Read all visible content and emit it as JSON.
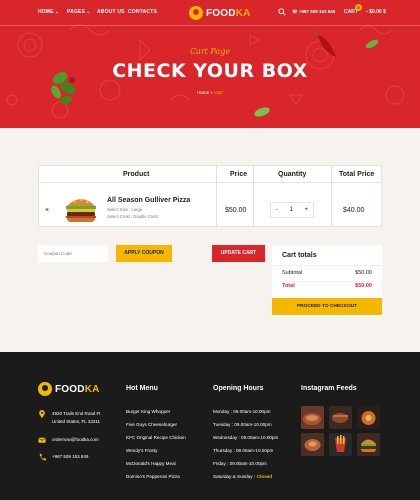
{
  "colors": {
    "brand_red": "#d8262b",
    "brand_yellow": "#f5b700",
    "footer_bg": "#1b1b1b",
    "page_bg": "#f6f3ee"
  },
  "nav": {
    "items": [
      {
        "label": "HOME",
        "has_dropdown": true
      },
      {
        "label": "PAGES",
        "has_dropdown": true
      },
      {
        "label": "ABOUT US",
        "has_dropdown": false
      },
      {
        "label": "CONTACTS",
        "has_dropdown": false
      }
    ],
    "logo": {
      "part1": "FOOD",
      "part2": "KA"
    },
    "search_icon": "search-icon",
    "phone": "+987 509 153 849",
    "cart_label": "CART",
    "cart_count": "0",
    "cart_total": "$0.00 $"
  },
  "hero": {
    "subtitle": "Cart Page",
    "title": "CHECK YOUR BOX",
    "breadcrumb": {
      "home": "Home",
      "separator": "»",
      "current": "Cart"
    }
  },
  "cart": {
    "headers": {
      "product": "Product",
      "price": "Price",
      "quantity": "Quantity",
      "total": "Total Price"
    },
    "items": [
      {
        "remove": "×",
        "name": "All Season Gulliver Pizza",
        "options": [
          "Select Size : Large",
          "Select Crust : Double Crust"
        ],
        "price": "$50.00",
        "qty_minus": "-",
        "qty": "1",
        "qty_plus": "+",
        "total": "$40.00"
      }
    ]
  },
  "coupon": {
    "placeholder": "Coupon Code",
    "apply_label": "APPLY COUPON",
    "update_label": "UPDATE CART"
  },
  "totals": {
    "title": "Cart totals",
    "subtotal_label": "Subtotal",
    "subtotal_value": "$50.00",
    "total_label": "Total",
    "total_value": "$50.00",
    "checkout_label": "PROCEED TO CHECKOUT"
  },
  "footer": {
    "logo": {
      "part1": "FOOD",
      "part2": "KA"
    },
    "address_line1": "4920 Trails End Road Ft",
    "address_line2": "United States, FL 33311",
    "email": "ordernow@foodka.com",
    "phone": "+987 509 153 849",
    "hot_menu_title": "Hot Menu",
    "hot_menu": [
      "Burger King Whopper",
      "Five Guys Cheeseburger",
      "KFC Original Recipe Chicken",
      "Wendy's Frosty",
      "McDonald's Happy Meal",
      "Domino's Pepperoni Pizza"
    ],
    "hours_title": "Opening Hours",
    "hours": [
      {
        "day": "Monday",
        "time": ": 09.00am-10.00pm"
      },
      {
        "day": "Tuesday",
        "time": ": 09.00am-10.00pm"
      },
      {
        "day": "Wednesday",
        "time": ": 09.00am-10.00pm"
      },
      {
        "day": "Thursday",
        "time": ": 09.00am-10.00pm"
      },
      {
        "day": "Friday",
        "time": ": 09.00am-10.00pm"
      },
      {
        "day": "Saturday & Sunday",
        "time": ": Closed"
      }
    ],
    "instagram_title": "Instagram Feeds"
  }
}
